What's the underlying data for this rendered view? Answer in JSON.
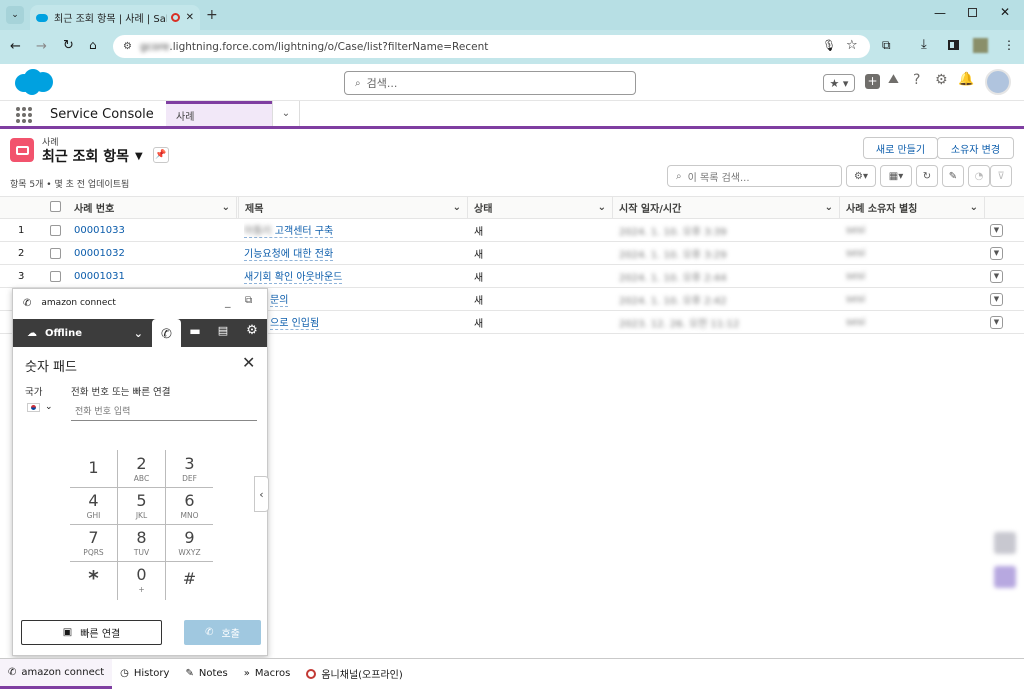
{
  "browser": {
    "tab_title": "최근 조회 항목 | 사례 | Sale",
    "url_blur": "gcore",
    "url": ".lightning.force.com/lightning/o/Case/list?filterName=Recent"
  },
  "header": {
    "search_placeholder": "검색..."
  },
  "nav": {
    "app_name": "Service Console",
    "tab_label": "사례"
  },
  "list": {
    "object_label": "사례",
    "title": "최근 조회 항목",
    "new_button": "새로 만들기",
    "owner_button": "소유자 변경",
    "status_line": "항목 5개 • 몇 초 전 업데이트됨",
    "search_placeholder": "이 목록 검색...",
    "columns": [
      "사례 번호",
      "제목",
      "상태",
      "시작 일자/시간",
      "사례 소유자 별칭"
    ],
    "rows": [
      {
        "num": "1",
        "case": "00001033",
        "subject_blur": "아톰리",
        "subject": "고객센터 구축",
        "status": "새",
        "date": "2024. 1. 10. 오후 3:39",
        "owner": "sesi"
      },
      {
        "num": "2",
        "case": "00001032",
        "subject_blur": "",
        "subject": "기능요청에 대한 전화",
        "status": "새",
        "date": "2024. 1. 10. 오후 3:29",
        "owner": "sesi"
      },
      {
        "num": "3",
        "case": "00001031",
        "subject_blur": "",
        "subject": "새기회 확인 아웃바운드",
        "status": "새",
        "date": "2024. 1. 10. 오후 2:44",
        "owner": "sesi"
      },
      {
        "num": "",
        "case": "",
        "subject_blur": "",
        "subject": "문의",
        "status": "새",
        "date": "2024. 1. 10. 오후 2:42",
        "owner": "sesi"
      },
      {
        "num": "",
        "case": "",
        "subject_blur": "",
        "subject": "으로 인입됨",
        "status": "새",
        "date": "2023. 12. 26. 오전 11:12",
        "owner": "sesi"
      }
    ]
  },
  "connect": {
    "header_title": "amazon connect",
    "status": "Offline",
    "dialpad_title": "숫자 패드",
    "country_label": "국가",
    "phone_label": "전화 번호 또는 빠른 연결",
    "phone_placeholder": "전화 번호 입력",
    "keys": [
      {
        "d": "1",
        "l": ""
      },
      {
        "d": "2",
        "l": "ABC"
      },
      {
        "d": "3",
        "l": "DEF"
      },
      {
        "d": "4",
        "l": "GHI"
      },
      {
        "d": "5",
        "l": "JKL"
      },
      {
        "d": "6",
        "l": "MNO"
      },
      {
        "d": "7",
        "l": "PQRS"
      },
      {
        "d": "8",
        "l": "TUV"
      },
      {
        "d": "9",
        "l": "WXYZ"
      },
      {
        "d": "*",
        "l": ""
      },
      {
        "d": "0",
        "l": "+"
      },
      {
        "d": "#",
        "l": ""
      }
    ],
    "quick_connect": "빠른 연결",
    "call": "호출"
  },
  "footer": {
    "items": [
      "amazon connect",
      "History",
      "Notes",
      "Macros",
      "옴니채널(오프라인)"
    ]
  },
  "colors": {
    "accent": "#7f3ea1",
    "link": "#0b5cab",
    "brand": "#00a1e0",
    "case_icon": "#f2536d"
  }
}
